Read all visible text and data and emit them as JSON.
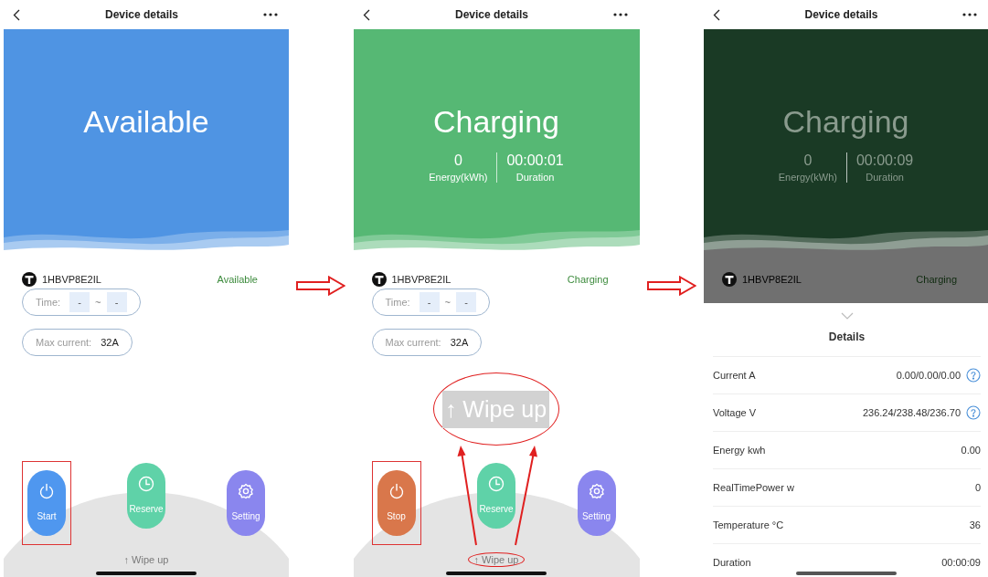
{
  "screens": [
    {
      "header": {
        "title": "Device details"
      },
      "dimmed": false,
      "hero": {
        "status": "Available",
        "color": "#4f94e3"
      },
      "device": {
        "id": "1HBVP8E2IL",
        "status": "Available"
      },
      "time": {
        "label": "Time:",
        "start": "-",
        "separator": "~",
        "end": "-"
      },
      "max_current": {
        "label": "Max current:",
        "value": "32A"
      },
      "actions": [
        {
          "label": "Start",
          "kind": "power",
          "color": "#4f97ef",
          "highlighted": true
        },
        {
          "label": "Reserve",
          "kind": "clock",
          "color": "#5fd2a8",
          "highlighted": false
        },
        {
          "label": "Setting",
          "kind": "gear",
          "color": "#8a86ee",
          "highlighted": false
        }
      ],
      "hint": {
        "text": "↑ Wipe up",
        "circled": false
      }
    },
    {
      "header": {
        "title": "Device details"
      },
      "dimmed": false,
      "hero": {
        "status": "Charging",
        "color": "#56b874",
        "stats": [
          {
            "value": "0",
            "label": "Energy(kWh)"
          },
          {
            "value": "00:00:01",
            "label": "Duration"
          }
        ]
      },
      "device": {
        "id": "1HBVP8E2IL",
        "status": "Charging"
      },
      "time": {
        "label": "Time:",
        "start": "-",
        "separator": "~",
        "end": "-"
      },
      "max_current": {
        "label": "Max current:",
        "value": "32A"
      },
      "actions": [
        {
          "label": "Stop",
          "kind": "power",
          "color": "#d9774b",
          "highlighted": true
        },
        {
          "label": "Reserve",
          "kind": "clock",
          "color": "#5fd2a8",
          "highlighted": false
        },
        {
          "label": "Setting",
          "kind": "gear",
          "color": "#8a86ee",
          "highlighted": false
        }
      ],
      "hint": {
        "text": "↑ Wipe up",
        "circled": true
      },
      "callout": {
        "text": "↑ Wipe up"
      }
    },
    {
      "header": {
        "title": "Device details"
      },
      "dimmed": true,
      "hero": {
        "status": "Charging",
        "color": "#1a3a25",
        "stats": [
          {
            "value": "0",
            "label": "Energy(kWh)"
          },
          {
            "value": "00:00:09",
            "label": "Duration"
          }
        ]
      },
      "device": {
        "id": "1HBVP8E2IL",
        "status": "Charging"
      },
      "sheet": {
        "title": "Details",
        "rows": [
          {
            "label": "Current A",
            "value": "0.00/0.00/0.00",
            "help": true
          },
          {
            "label": "Voltage V",
            "value": "236.24/238.48/236.70",
            "help": true
          },
          {
            "label": "Energy kwh",
            "value": "0.00",
            "help": false
          },
          {
            "label": "RealTimePower w",
            "value": "0",
            "help": false
          },
          {
            "label": "Temperature °C",
            "value": "36",
            "help": false
          },
          {
            "label": "Duration",
            "value": "00:00:09",
            "help": false
          }
        ]
      }
    }
  ]
}
